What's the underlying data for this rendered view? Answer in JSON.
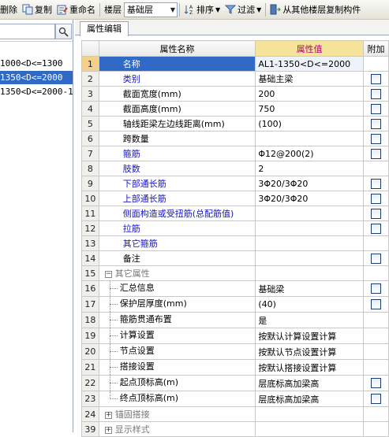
{
  "toolbar": {
    "delete_label": "删除",
    "copy_label": "复制",
    "rename_label": "重命名",
    "floor_label": "楼层",
    "floor_value": "基础层",
    "sort_label": "排序",
    "filter_label": "过滤",
    "copy_from_label": "从其他楼层复制构件"
  },
  "left": {
    "search_placeholder": "",
    "items": [
      {
        "label": "1000<D<=1300"
      },
      {
        "label": "1350<D<=2000"
      },
      {
        "label": "1350<D<=2000-1"
      }
    ]
  },
  "tab": {
    "label": "属性编辑"
  },
  "grid": {
    "headers": {
      "name": "属性名称",
      "value": "属性值",
      "add": "附加"
    },
    "rows": [
      {
        "num": "1",
        "name": "名称",
        "value": "AL1-1350<D<=2000"
      },
      {
        "num": "2",
        "name": "类别",
        "value": "基础主梁"
      },
      {
        "num": "3",
        "name": "截面宽度(mm)",
        "value": "200"
      },
      {
        "num": "4",
        "name": "截面高度(mm)",
        "value": "750"
      },
      {
        "num": "5",
        "name": "轴线距梁左边线距离(mm)",
        "value": "(100)"
      },
      {
        "num": "6",
        "name": "跨数量",
        "value": ""
      },
      {
        "num": "7",
        "name": "箍筋",
        "value": "Φ12@200(2)"
      },
      {
        "num": "8",
        "name": "肢数",
        "value": "2"
      },
      {
        "num": "9",
        "name": "下部通长筋",
        "value": "3Φ20/3Φ20"
      },
      {
        "num": "10",
        "name": "上部通长筋",
        "value": "3Φ20/3Φ20"
      },
      {
        "num": "11",
        "name": "侧面构造或受扭筋(总配筋值)",
        "value": ""
      },
      {
        "num": "12",
        "name": "拉筋",
        "value": ""
      },
      {
        "num": "13",
        "name": "其它箍筋",
        "value": ""
      },
      {
        "num": "14",
        "name": "备注",
        "value": ""
      },
      {
        "num": "15",
        "name": "其它属性",
        "value": ""
      },
      {
        "num": "16",
        "name": "汇总信息",
        "value": "基础梁"
      },
      {
        "num": "17",
        "name": "保护层厚度(mm)",
        "value": "(40)"
      },
      {
        "num": "18",
        "name": "箍筋贯通布置",
        "value": "是"
      },
      {
        "num": "19",
        "name": "计算设置",
        "value": "按默认计算设置计算"
      },
      {
        "num": "20",
        "name": "节点设置",
        "value": "按默认节点设置计算"
      },
      {
        "num": "21",
        "name": "搭接设置",
        "value": "按默认搭接设置计算"
      },
      {
        "num": "22",
        "name": "起点顶标高(m)",
        "value": "层底标高加梁高"
      },
      {
        "num": "23",
        "name": "终点顶标高(m)",
        "value": "层底标高加梁高"
      },
      {
        "num": "24",
        "name": "锚固搭接",
        "value": ""
      },
      {
        "num": "39",
        "name": "显示样式",
        "value": ""
      }
    ]
  }
}
